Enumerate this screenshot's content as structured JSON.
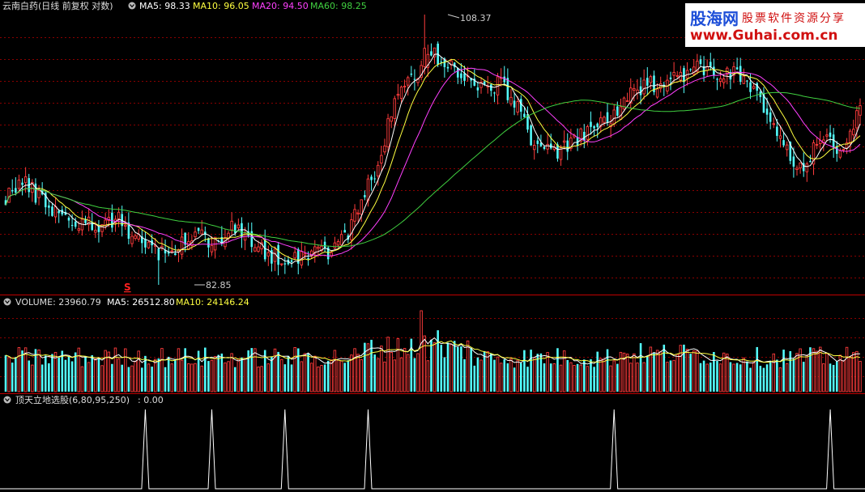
{
  "header": {
    "title": "云南白药(日线 前复权 对数)",
    "ma5": "MA5: 98.33",
    "ma10": "MA10: 96.05",
    "ma20": "MA20: 94.50",
    "ma60": "MA60: 98.25"
  },
  "watermark": {
    "brand": "股海网",
    "slogan": "股票软件资源分享",
    "url": "www.Guhai.com.cn"
  },
  "volume_header": {
    "volume": "VOLUME: 23960.79",
    "ma5": "MA5: 26512.80",
    "ma10": "MA10: 24146.24"
  },
  "indicator_header": {
    "label": "顶天立地选股(6,80,95,250)",
    "value": ": 0.00"
  },
  "annotations": {
    "high": "108.37",
    "low": "82.85",
    "signal": "S"
  },
  "colors": {
    "up": "#ff3c3c",
    "down": "#54ffff",
    "ma5": "#ffffff",
    "ma10": "#ffff40",
    "ma20": "#ff40ff",
    "ma60": "#40d040",
    "grid": "#8a0000",
    "separator": "#c00000",
    "icon": "#bbbbbb"
  },
  "chart_data": {
    "type": "candlestick",
    "price_anchors": [
      [
        0,
        90.5
      ],
      [
        5,
        91.8
      ],
      [
        10,
        90.4
      ],
      [
        15,
        89.2
      ],
      [
        20,
        88.3
      ],
      [
        23,
        88.0
      ],
      [
        28,
        87.9
      ],
      [
        33,
        88.6
      ],
      [
        38,
        87.2
      ],
      [
        43,
        86.2
      ],
      [
        48,
        85.2
      ],
      [
        53,
        86.5
      ],
      [
        58,
        87.1
      ],
      [
        63,
        86.5
      ],
      [
        68,
        87.8
      ],
      [
        73,
        86.4
      ],
      [
        78,
        85.6
      ],
      [
        83,
        85.0
      ],
      [
        88,
        85.3
      ],
      [
        93,
        85.9
      ],
      [
        98,
        85.6
      ],
      [
        103,
        87.4
      ],
      [
        108,
        90.5
      ],
      [
        113,
        94.5
      ],
      [
        118,
        100.5
      ],
      [
        123,
        101.8
      ],
      [
        128,
        104.2
      ],
      [
        133,
        103.4
      ],
      [
        138,
        101.6
      ],
      [
        143,
        100.6
      ],
      [
        148,
        101.2
      ],
      [
        153,
        99.6
      ],
      [
        158,
        96.0
      ],
      [
        163,
        94.5
      ],
      [
        168,
        94.8
      ],
      [
        173,
        95.9
      ],
      [
        178,
        97.1
      ],
      [
        183,
        98.1
      ],
      [
        188,
        99.9
      ],
      [
        193,
        100.9
      ],
      [
        198,
        101.7
      ],
      [
        203,
        102.1
      ],
      [
        208,
        102.7
      ],
      [
        213,
        102.4
      ],
      [
        218,
        102.2
      ],
      [
        223,
        101.4
      ],
      [
        228,
        98.6
      ],
      [
        233,
        95.8
      ],
      [
        236,
        93.9
      ],
      [
        239,
        92.7
      ],
      [
        242,
        94.2
      ],
      [
        245,
        95.4
      ],
      [
        248,
        96.3
      ],
      [
        251,
        94.6
      ],
      [
        254,
        96.4
      ],
      [
        257,
        98.3
      ]
    ],
    "y_log": true,
    "y_range": [
      82.85,
      108.37
    ],
    "indicator_spike_days": [
      42,
      62,
      84,
      109,
      183,
      248
    ],
    "indicator_range": [
      0,
      1
    ]
  }
}
